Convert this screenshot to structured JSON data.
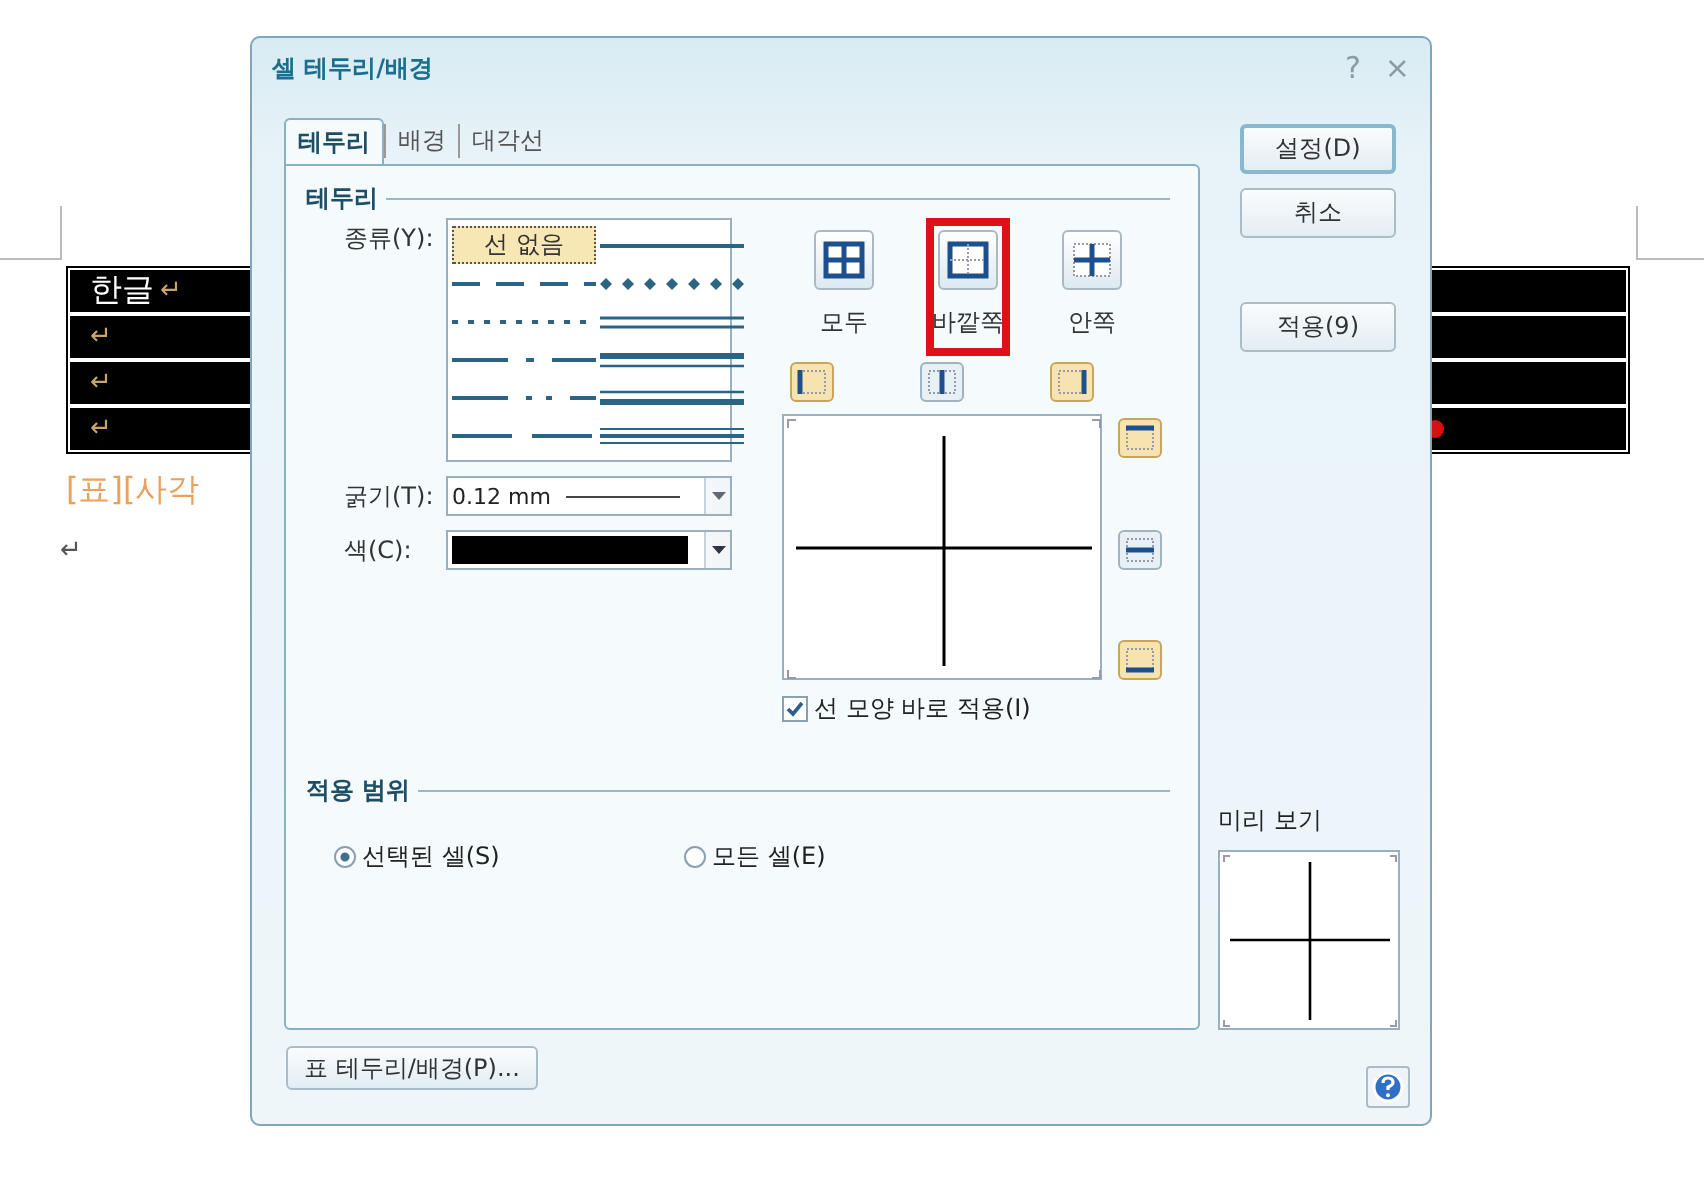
{
  "document": {
    "rows": [
      {
        "text": "한글",
        "return_mark": "↵",
        "marker": false
      },
      {
        "return_mark": "↵",
        "marker": false
      },
      {
        "return_mark": "↵",
        "marker": false
      },
      {
        "return_mark": "↵",
        "marker": true
      }
    ],
    "caption": "[표][사각",
    "empty_line_mark": "↵"
  },
  "dialog": {
    "title": "셀 테두리/배경",
    "help_glyph": "?",
    "close_glyph": "×",
    "tabs": [
      {
        "label": "테두리",
        "selected": true
      },
      {
        "label": "배경",
        "selected": false
      },
      {
        "label": "대각선",
        "selected": false
      }
    ],
    "border_section": {
      "title": "테두리",
      "type_label": "종류(Y):",
      "line_styles": [
        {
          "kind": "none",
          "label": "선 없음",
          "selected": true
        },
        {
          "kind": "solid",
          "selected": false
        },
        {
          "kind": "dash",
          "selected": false
        },
        {
          "kind": "dots",
          "selected": false
        },
        {
          "kind": "dotted",
          "selected": false
        },
        {
          "kind": "double",
          "selected": false
        },
        {
          "kind": "dash-dot",
          "selected": false
        },
        {
          "kind": "thick-thin",
          "selected": false
        },
        {
          "kind": "dash-dot-dot",
          "selected": false
        },
        {
          "kind": "thin-thick",
          "selected": false
        },
        {
          "kind": "long-dash",
          "selected": false
        },
        {
          "kind": "triple",
          "selected": false
        }
      ],
      "thickness": {
        "label": "굵기(T):",
        "value": "0.12 mm"
      },
      "color": {
        "label": "색(C):",
        "color": "#000000"
      },
      "presets": [
        {
          "kind": "all",
          "label": "모두",
          "highlighted": false
        },
        {
          "kind": "outer",
          "label": "바깥쪽",
          "highlighted": true
        },
        {
          "kind": "inner",
          "label": "안쪽",
          "highlighted": false
        }
      ],
      "edges": [
        {
          "kind": "left",
          "on": true
        },
        {
          "kind": "vcenter",
          "on": false
        },
        {
          "kind": "right",
          "on": true
        },
        {
          "kind": "top",
          "on": true
        },
        {
          "kind": "hcenter",
          "on": false
        },
        {
          "kind": "bottom",
          "on": true
        }
      ],
      "apply_now": {
        "label": "선 모양 바로 적용(I)",
        "checked": true
      }
    },
    "scope": {
      "title": "적용 범위",
      "options": [
        {
          "label": "선택된 셀(S)",
          "selected": true
        },
        {
          "label": "모든 셀(E)",
          "selected": false
        }
      ]
    },
    "buttons": [
      {
        "label": "설정(D)",
        "default": true
      },
      {
        "label": "취소",
        "default": false
      },
      {
        "label": "적용(9)",
        "default": false
      }
    ],
    "preview": {
      "label": "미리 보기"
    },
    "table_button": "표 테두리/배경(P)..."
  }
}
